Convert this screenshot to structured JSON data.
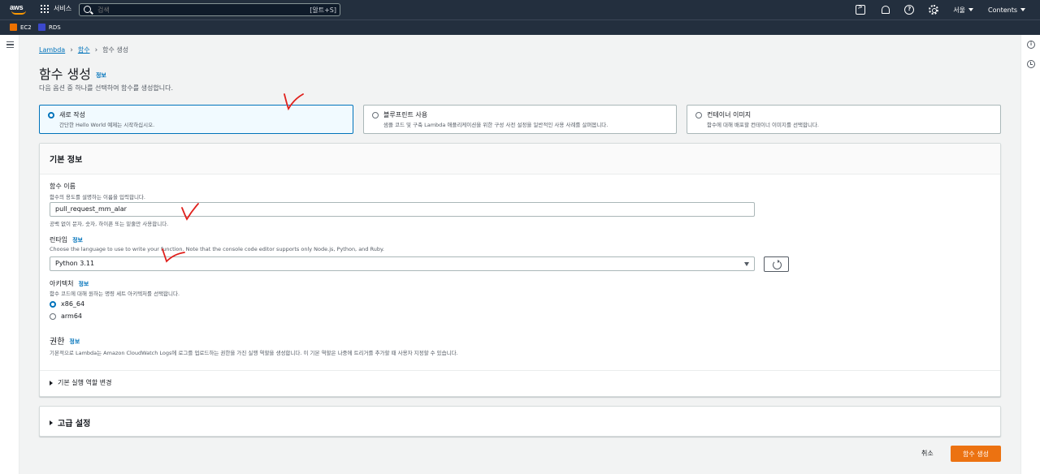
{
  "topbar": {
    "logo_text": "aws",
    "services_label": "서비스",
    "search_placeholder": "검색",
    "search_shortcut": "[알트+S]",
    "region": "서울",
    "account": "Contents"
  },
  "favorites": [
    {
      "label": "EC2",
      "color": "#ed7100"
    },
    {
      "label": "RDS",
      "color": "#3b48cc"
    }
  ],
  "breadcrumb": {
    "root": "Lambda",
    "parent": "함수",
    "current": "함수 생성"
  },
  "page": {
    "title": "함수 생성",
    "info": "정보",
    "subtitle": "다음 옵션 중 하나를 선택하여 함수를 생성합니다."
  },
  "options": [
    {
      "title": "새로 작성",
      "desc": "간단한 Hello World 예제는 시작하십시오.",
      "selected": true
    },
    {
      "title": "블루프린트 사용",
      "desc": "샘플 코드 및 구축 Lambda 애플리케이션을 위한 구성 사전 설정을 일반적인 사용 사례를 살펴봅니다.",
      "selected": false
    },
    {
      "title": "컨테이너 이미지",
      "desc": "함수에 대해 배포할 컨테이너 이미지를 선택합니다.",
      "selected": false
    }
  ],
  "basic": {
    "title": "기본 정보",
    "name_label": "함수 이름",
    "name_desc": "함수의 용도를 설명하는 이름을 입력합니다.",
    "name_value": "pull_request_mm_alar",
    "name_hint": "공백 없이 문자, 숫자, 하이픈 또는 밑줄만 사용합니다.",
    "runtime_label": "런타임",
    "runtime_info": "정보",
    "runtime_desc": "Choose the language to use to write your function. Note that the console code editor supports only Node.js, Python, and Ruby.",
    "runtime_value": "Python 3.11",
    "arch_label": "아키텍처",
    "arch_info": "정보",
    "arch_desc": "함수 코드에 대해 원하는 명령 세트 아키텍처를 선택합니다.",
    "arch_options": [
      {
        "label": "x86_64",
        "selected": true
      },
      {
        "label": "arm64",
        "selected": false
      }
    ],
    "perm_label": "권한",
    "perm_info": "정보",
    "perm_desc": "기본적으로 Lambda는 Amazon CloudWatch Logs에 로그를 업로드하는 권한을 가진 실행 역할을 생성합니다. 이 기본 역할은 나중에 트리거를 추가할 때 사용자 지정할 수 있습니다.",
    "role_expander": "기본 실행 역할 변경"
  },
  "advanced": {
    "label": "고급 설정"
  },
  "footer": {
    "cancel": "취소",
    "create": "함수 생성"
  }
}
